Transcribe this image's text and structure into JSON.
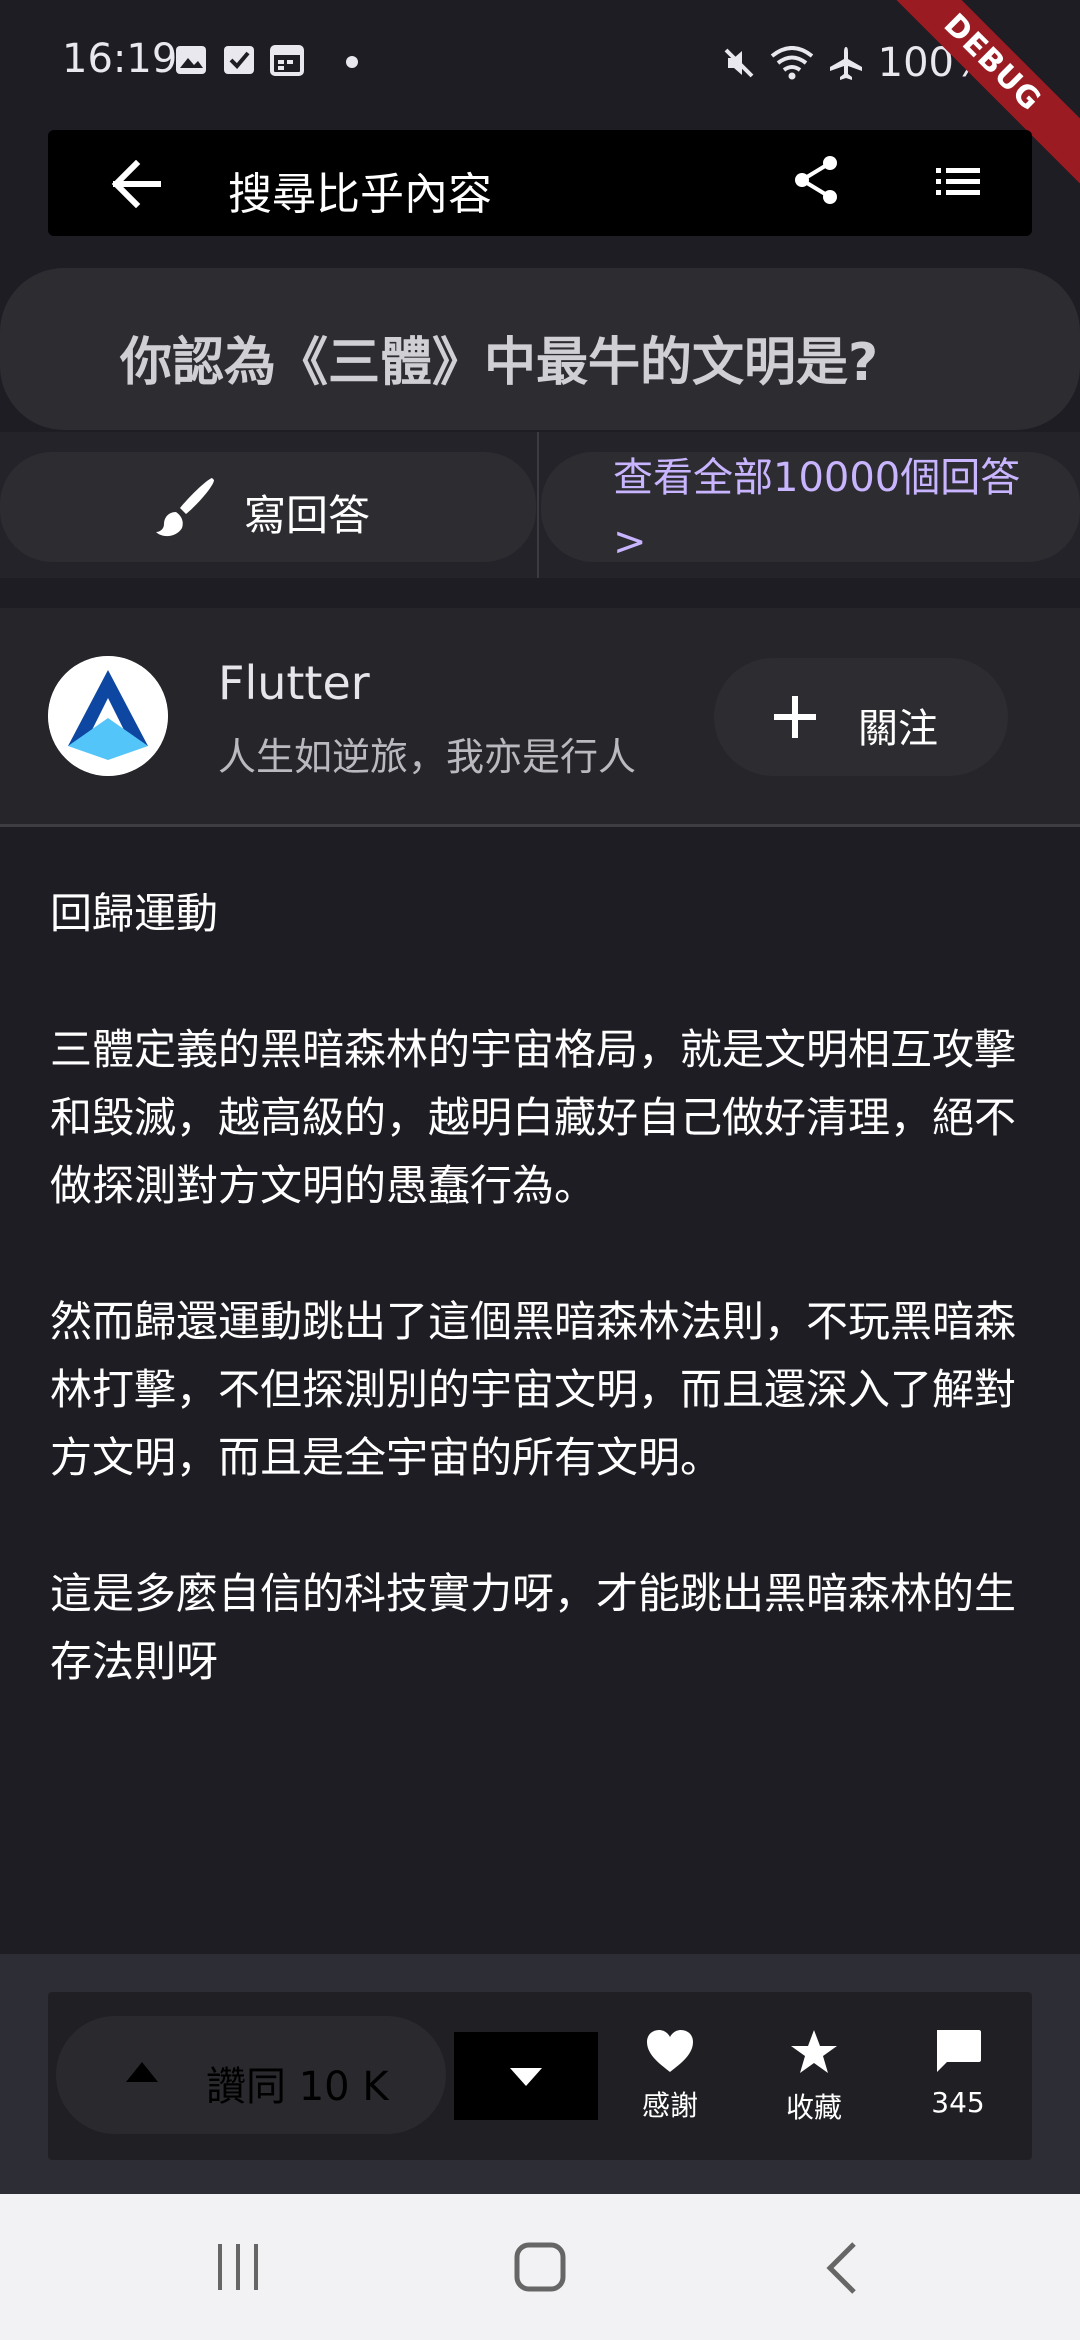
{
  "status_bar": {
    "time": "16:19",
    "battery": "100%",
    "debug_banner": "DEBUG"
  },
  "app_bar": {
    "search_placeholder": "搜尋比乎內容"
  },
  "question": {
    "title": "你認為《三體》中最牛的文明是?"
  },
  "actions": {
    "write_answer": "寫回答",
    "view_all": "查看全部10000個回答 >"
  },
  "author": {
    "name": "Flutter",
    "bio": "人生如逆旅，我亦是行人",
    "follow_label": "關注"
  },
  "answer": {
    "paragraphs": [
      "回歸運動",
      "三體定義的黑暗森林的宇宙格局，就是文明相互攻擊和毀滅，越高級的，越明白藏好自己做好清理，絕不做探測對方文明的愚蠢行為。",
      "然而歸還運動跳出了這個黑暗森林法則，不玩黑暗森林打擊，不但探測別的宇宙文明，而且還深入了解對方文明，而且是全宇宙的所有文明。",
      "這是多麼自信的科技實力呀，才能跳出黑暗森林的生存法則呀"
    ]
  },
  "bottom_bar": {
    "agree_label": "讚同 10 K",
    "thanks_label": "感謝",
    "collect_label": "收藏",
    "comments_count": "345"
  },
  "colors": {
    "background": "#1e1d24",
    "accent_link": "#c9b4ff",
    "debug": "#9b1b22"
  }
}
